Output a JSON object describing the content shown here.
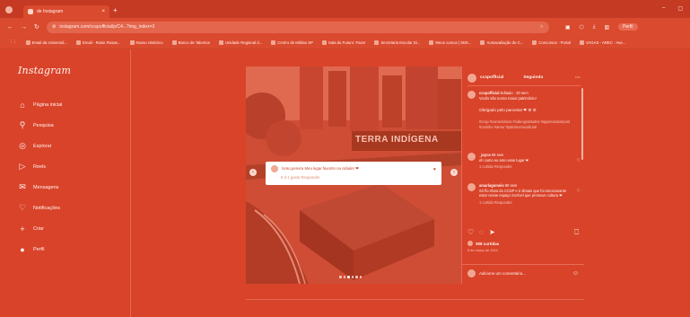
{
  "browser": {
    "tab_title": "de Instagram",
    "url": "instagram.com/ccspofficial/p/C4...?img_index=3",
    "profile_label": "Perfil",
    "bookmarks": [
      "Email da Universid...",
      "Email - Rosie Rosas...",
      "Nosso Histórico",
      "Banco de Talentos",
      "Unidade Regional d...",
      "Centro de Mídias SP",
      "Sala do Futuro: Fazer",
      "Secretaria Escolar Di...",
      "Meus cursos | SEE...",
      "Autoavaliação do C...",
      "Concursos - Portal",
      "VAGAS - AREC - Ave..."
    ]
  },
  "instagram": {
    "logo": "Instagram",
    "nav": [
      {
        "label": "Página inicial",
        "icon": "home-icon"
      },
      {
        "label": "Pesquisa",
        "icon": "search-icon"
      },
      {
        "label": "Explorar",
        "icon": "compass-icon"
      },
      {
        "label": "Reels",
        "icon": "reels-icon"
      },
      {
        "label": "Mensagens",
        "icon": "messenger-icon"
      },
      {
        "label": "Notificações",
        "icon": "heart-icon"
      },
      {
        "label": "Criar",
        "icon": "plus-icon"
      },
      {
        "label": "Perfil",
        "icon": "avatar-icon"
      }
    ]
  },
  "post": {
    "author": "ccspofficial",
    "follow_label": "Seguindo",
    "caption_author": "ccspofficial",
    "caption_meta": "Editado · 20 sem",
    "caption_text": "Vocês são nosso maior patrimônio!",
    "caption_thanks": "Obrigado pelo parceria! ❤ ⚙ ⚙",
    "hashtags": "#ccsp #comentários #videogratitudes #appreciationpost #carinho #amor #patrimoniocultural",
    "comments": [
      {
        "user": "_joyce",
        "time": "89 sem",
        "text": "eh como eu amo esse lugar ❤",
        "meta": "1 curtida  Responder"
      },
      {
        "user": "amarlagomeio",
        "time": "89 sem",
        "text": "Só flo show do CCSP e é dimais que foi emocionante estar nesse espaço incrível que promove cultura ❤",
        "meta": "1 curtida  Responder"
      }
    ],
    "likes": "308 curtidas",
    "date": "8 de março de 2024",
    "add_comment_placeholder": "Adicione um comentário...",
    "tag_popup": {
      "text": "lorao.pereira Meu lugar favorito na cidade! ❤",
      "meta": "8 d   1 gosto   Responder"
    },
    "graffiti_text": "TERRA INDÍGENA",
    "carousel_count": 6,
    "carousel_active": 2
  }
}
